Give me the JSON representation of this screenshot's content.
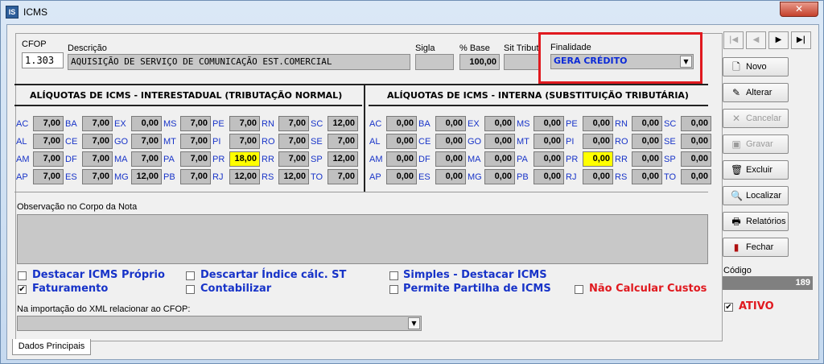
{
  "window": {
    "title": "ICMS",
    "app_icon": "IS"
  },
  "fields": {
    "cfop_label": "CFOP",
    "cfop_value": "1.303",
    "descricao_label": "Descrição",
    "descricao_value": "AQUISIÇÃO DE SERVIÇO DE COMUNICAÇÃO EST.COMERCIAL",
    "sigla_label": "Sigla",
    "sigla_value": "",
    "base_label": "% Base",
    "base_value": "100,00",
    "sit_label": "Sit Tribut",
    "sit_value": "",
    "finalidade_label": "Finalidade",
    "finalidade_value": "GERA CRÉDITO"
  },
  "interestadual": {
    "title": "ALÍQUOTAS DE ICMS - INTERESTADUAL (TRIBUTAÇÃO NORMAL)",
    "rows": [
      [
        {
          "uf": "AC",
          "v": "7,00"
        },
        {
          "uf": "BA",
          "v": "7,00"
        },
        {
          "uf": "EX",
          "v": "0,00"
        },
        {
          "uf": "MS",
          "v": "7,00"
        },
        {
          "uf": "PE",
          "v": "7,00"
        },
        {
          "uf": "RN",
          "v": "7,00"
        },
        {
          "uf": "SC",
          "v": "12,00"
        }
      ],
      [
        {
          "uf": "AL",
          "v": "7,00"
        },
        {
          "uf": "CE",
          "v": "7,00"
        },
        {
          "uf": "GO",
          "v": "7,00"
        },
        {
          "uf": "MT",
          "v": "7,00"
        },
        {
          "uf": "PI",
          "v": "7,00"
        },
        {
          "uf": "RO",
          "v": "7,00"
        },
        {
          "uf": "SE",
          "v": "7,00"
        }
      ],
      [
        {
          "uf": "AM",
          "v": "7,00"
        },
        {
          "uf": "DF",
          "v": "7,00"
        },
        {
          "uf": "MA",
          "v": "7,00"
        },
        {
          "uf": "PA",
          "v": "7,00"
        },
        {
          "uf": "PR",
          "v": "18,00",
          "hl": true
        },
        {
          "uf": "RR",
          "v": "7,00"
        },
        {
          "uf": "SP",
          "v": "12,00"
        }
      ],
      [
        {
          "uf": "AP",
          "v": "7,00"
        },
        {
          "uf": "ES",
          "v": "7,00"
        },
        {
          "uf": "MG",
          "v": "12,00"
        },
        {
          "uf": "PB",
          "v": "7,00"
        },
        {
          "uf": "RJ",
          "v": "12,00"
        },
        {
          "uf": "RS",
          "v": "12,00"
        },
        {
          "uf": "TO",
          "v": "7,00"
        }
      ]
    ]
  },
  "interna": {
    "title": "ALÍQUOTAS DE ICMS - INTERNA (SUBSTITUIÇÃO TRIBUTÁRIA)",
    "rows": [
      [
        {
          "uf": "AC",
          "v": "0,00"
        },
        {
          "uf": "BA",
          "v": "0,00"
        },
        {
          "uf": "EX",
          "v": "0,00"
        },
        {
          "uf": "MS",
          "v": "0,00"
        },
        {
          "uf": "PE",
          "v": "0,00"
        },
        {
          "uf": "RN",
          "v": "0,00"
        },
        {
          "uf": "SC",
          "v": "0,00"
        }
      ],
      [
        {
          "uf": "AL",
          "v": "0,00"
        },
        {
          "uf": "CE",
          "v": "0,00"
        },
        {
          "uf": "GO",
          "v": "0,00"
        },
        {
          "uf": "MT",
          "v": "0,00"
        },
        {
          "uf": "PI",
          "v": "0,00"
        },
        {
          "uf": "RO",
          "v": "0,00"
        },
        {
          "uf": "SE",
          "v": "0,00"
        }
      ],
      [
        {
          "uf": "AM",
          "v": "0,00"
        },
        {
          "uf": "DF",
          "v": "0,00"
        },
        {
          "uf": "MA",
          "v": "0,00"
        },
        {
          "uf": "PA",
          "v": "0,00"
        },
        {
          "uf": "PR",
          "v": "0,00",
          "hl": true
        },
        {
          "uf": "RR",
          "v": "0,00"
        },
        {
          "uf": "SP",
          "v": "0,00"
        }
      ],
      [
        {
          "uf": "AP",
          "v": "0,00"
        },
        {
          "uf": "ES",
          "v": "0,00"
        },
        {
          "uf": "MG",
          "v": "0,00"
        },
        {
          "uf": "PB",
          "v": "0,00"
        },
        {
          "uf": "RJ",
          "v": "0,00"
        },
        {
          "uf": "RS",
          "v": "0,00"
        },
        {
          "uf": "TO",
          "v": "0,00"
        }
      ]
    ]
  },
  "observacao_label": "Observação no Corpo da Nota",
  "checkboxes": {
    "destacar_icms_proprio": {
      "label": "Destacar ICMS Próprio",
      "checked": false
    },
    "faturamento": {
      "label": "Faturamento",
      "checked": true
    },
    "descartar_indice": {
      "label": "Descartar Índice cálc. ST",
      "checked": false
    },
    "contabilizar": {
      "label": "Contabilizar",
      "checked": false
    },
    "simples_destacar": {
      "label": "Simples - Destacar ICMS",
      "checked": false
    },
    "permite_partilha": {
      "label": "Permite Partilha de ICMS",
      "checked": false
    },
    "nao_calcular_custos": {
      "label": "Não Calcular Custos",
      "checked": false
    }
  },
  "xml_label": "Na importação do XML relacionar ao CFOP:",
  "tab_label": "Dados Principais",
  "nav": {
    "first": "|◀",
    "prev": "◀",
    "next": "▶",
    "last": "▶|"
  },
  "buttons": {
    "novo": "Novo",
    "alterar": "Alterar",
    "cancelar": "Cancelar",
    "gravar": "Gravar",
    "excluir": "Excluir",
    "localizar": "Localizar",
    "relatorios": "Relatórios",
    "fechar": "Fechar"
  },
  "codigo": {
    "label": "Código",
    "value": "189"
  },
  "ativo": {
    "label": "ATIVO",
    "checked": true
  },
  "colors": {
    "label_blue": "#1733c8",
    "highlight": "#ffff00",
    "red": "#e0191f"
  }
}
